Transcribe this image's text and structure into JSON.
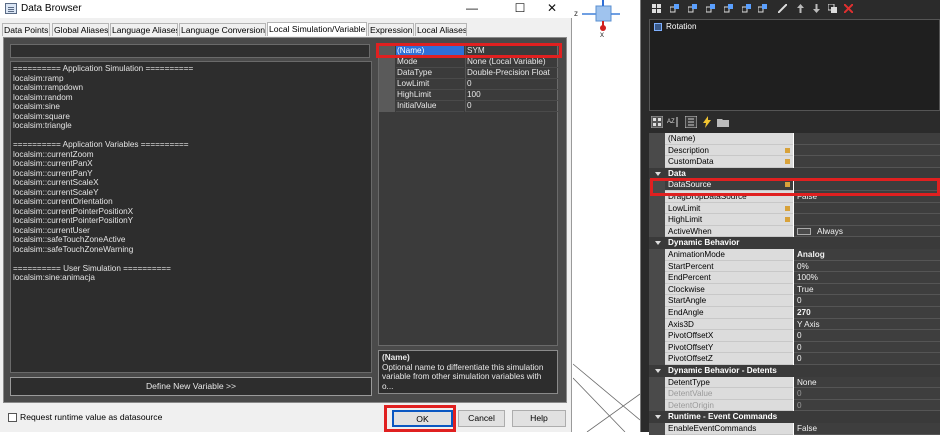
{
  "window": {
    "title": "Data Browser",
    "controls": [
      "—",
      "☐",
      "✕"
    ]
  },
  "tabs": [
    {
      "label": "Data Points"
    },
    {
      "label": "Global Aliases"
    },
    {
      "label": "Language Aliases"
    },
    {
      "label": "Language Conversions"
    },
    {
      "label": "Local Simulation/Variables"
    },
    {
      "label": "Expression"
    },
    {
      "label": "Local Aliases"
    }
  ],
  "variable_list": [
    "========== Application Simulation ==========",
    "localsim:ramp",
    "localsim:rampdown",
    "localsim:random",
    "localsim:sine",
    "localsim:square",
    "localsim:triangle",
    "",
    "========== Application Variables ==========",
    "localsim::currentZoom",
    "localsim::currentPanX",
    "localsim::currentPanY",
    "localsim::currentScaleX",
    "localsim::currentScaleY",
    "localsim::currentOrientation",
    "localsim::currentPointerPositionX",
    "localsim::currentPointerPositionY",
    "localsim::currentUser",
    "localsim::safeTouchZoneActive",
    "localsim::safeTouchZoneWarning",
    "",
    "========== User Simulation ==========",
    "localsim:sine:animacja"
  ],
  "define_button": "Define New Variable >>",
  "property_grid": [
    {
      "name": "(Name)",
      "value": "SYM"
    },
    {
      "name": "Mode",
      "value": "None (Local Variable)"
    },
    {
      "name": "DataType",
      "value": "Double-Precision Float"
    },
    {
      "name": "LowLimit",
      "value": "0"
    },
    {
      "name": "HighLimit",
      "value": "100"
    },
    {
      "name": "InitialValue",
      "value": "0"
    }
  ],
  "description": {
    "title": "(Name)",
    "text": "Optional name to differentiate this simulation variable from other simulation variables with o..."
  },
  "runtime_checkbox": "Request runtime value as datasource",
  "buttons": {
    "ok": "OK",
    "cancel": "Cancel",
    "help": "Help"
  },
  "gizmo": {
    "z": "z",
    "x": "x"
  },
  "animation_list": {
    "item": "Rotation"
  },
  "properties": [
    {
      "type": "prop",
      "name": "(Name)",
      "value": ""
    },
    {
      "type": "prop",
      "name": "Description",
      "value": "",
      "mark": true
    },
    {
      "type": "prop",
      "name": "CustomData",
      "value": "",
      "mark": true
    },
    {
      "type": "cat",
      "label": "Data"
    },
    {
      "type": "prop",
      "name": "DataSource",
      "value": "",
      "mark": true,
      "selected": true
    },
    {
      "type": "prop",
      "name": "DragDropDataSource",
      "value": "False"
    },
    {
      "type": "prop",
      "name": "LowLimit",
      "value": "",
      "mark": true
    },
    {
      "type": "prop",
      "name": "HighLimit",
      "value": "",
      "mark": true
    },
    {
      "type": "prop",
      "name": "ActiveWhen",
      "value": "Always",
      "swatch": true
    },
    {
      "type": "cat",
      "label": "Dynamic Behavior"
    },
    {
      "type": "prop",
      "name": "AnimationMode",
      "value": "Analog",
      "bold": true
    },
    {
      "type": "prop",
      "name": "StartPercent",
      "value": "0%"
    },
    {
      "type": "prop",
      "name": "EndPercent",
      "value": "100%"
    },
    {
      "type": "prop",
      "name": "Clockwise",
      "value": "True"
    },
    {
      "type": "prop",
      "name": "StartAngle",
      "value": "0"
    },
    {
      "type": "prop",
      "name": "EndAngle",
      "value": "270",
      "bold": true
    },
    {
      "type": "prop",
      "name": "Axis3D",
      "value": "Y Axis"
    },
    {
      "type": "prop",
      "name": "PivotOffsetX",
      "value": "0"
    },
    {
      "type": "prop",
      "name": "PivotOffsetY",
      "value": "0"
    },
    {
      "type": "prop",
      "name": "PivotOffsetZ",
      "value": "0"
    },
    {
      "type": "cat",
      "label": "Dynamic Behavior - Detents"
    },
    {
      "type": "prop",
      "name": "DetentType",
      "value": "None"
    },
    {
      "type": "prop",
      "name": "DetentValue",
      "value": "0",
      "dim": true
    },
    {
      "type": "prop",
      "name": "DetentOrigin",
      "value": "0",
      "dim": true
    },
    {
      "type": "cat",
      "label": "Runtime - Event Commands"
    },
    {
      "type": "prop",
      "name": "EnableEventCommands",
      "value": "False"
    }
  ],
  "colors": {
    "highlight": "#e02020",
    "selection": "#2f6fd6",
    "dialog_dark": "#4a4a4a"
  }
}
